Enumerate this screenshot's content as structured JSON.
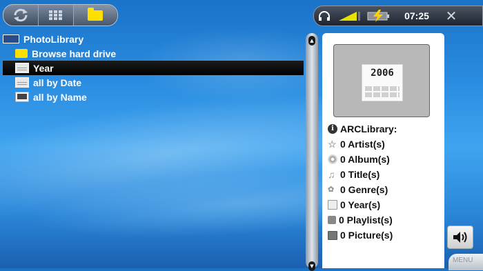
{
  "topbar": {
    "time": "07:25",
    "close_glyph": "✕"
  },
  "tree": {
    "root": "PhotoLibrary",
    "items": [
      {
        "label": "Browse hard drive",
        "icon": "folder-icon"
      },
      {
        "label": "Year",
        "icon": "calendar-year-icon",
        "selected": true
      },
      {
        "label": "all by Date",
        "icon": "calendar-year-icon"
      },
      {
        "label": "all by Name",
        "icon": "picture-icon"
      }
    ]
  },
  "panel": {
    "thumbnail_year": "2006",
    "library_title": "ARCLibrary:",
    "stats": [
      {
        "label": "0 Artist(s)",
        "icon": "artist-star-icon"
      },
      {
        "label": "0 Album(s)",
        "icon": "album-cd-icon"
      },
      {
        "label": "0 Title(s)",
        "icon": "title-note-icon"
      },
      {
        "label": "0 Genre(s)",
        "icon": "genre-icon"
      },
      {
        "label": "0 Year(s)",
        "icon": "year-icon"
      },
      {
        "label": "0 Playlist(s)",
        "icon": "playlist-icon"
      },
      {
        "label": "0 Picture(s)",
        "icon": "picture-icon"
      }
    ]
  },
  "buttons": {
    "menu_label": "MENU"
  },
  "colors": {
    "background_blue": "#2a8ce0",
    "folder_yellow": "#ffe000",
    "selection": "#000000",
    "battery_lightning": "#ffd000",
    "signal_yellow": "#e8e000"
  }
}
